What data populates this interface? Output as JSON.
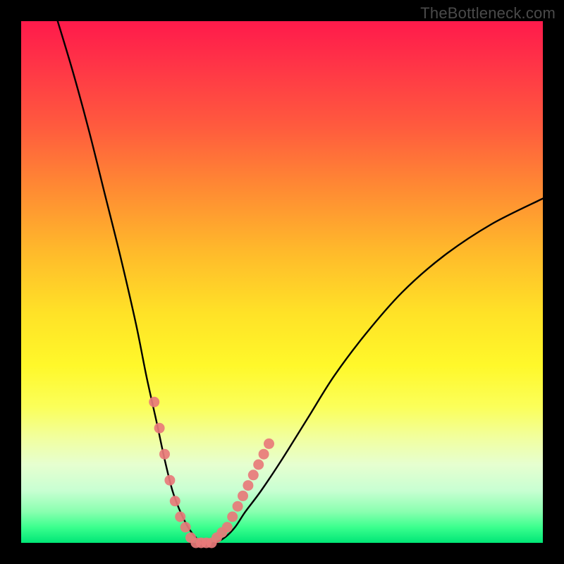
{
  "watermark": "TheBottleneck.com",
  "colors": {
    "frame": "#000000",
    "curve": "#000000",
    "marker": "#e87a7a",
    "gradient_top": "#ff1a4b",
    "gradient_bottom": "#00e676"
  },
  "chart_data": {
    "type": "line",
    "title": "",
    "xlabel": "",
    "ylabel": "",
    "xlim": [
      0,
      100
    ],
    "ylim": [
      0,
      100
    ],
    "grid": false,
    "legend": false,
    "note": "Bottleneck-style V-curve. x is a normalized hardware balance axis (0–100). y is estimated bottleneck percentage (0 at the valley, ~100 at the top). Values are read off the figure; no axis ticks are rendered, so all numbers are approximate to ±3.",
    "series": [
      {
        "name": "bottleneck-curve",
        "x": [
          7,
          10,
          13,
          16,
          19,
          22,
          24,
          26,
          27.5,
          29,
          30.5,
          32,
          33.5,
          35,
          37,
          39,
          41,
          43,
          46,
          50,
          55,
          60,
          66,
          73,
          81,
          90,
          100
        ],
        "y": [
          100,
          90,
          79,
          67,
          55,
          42,
          32,
          23,
          16,
          10,
          6,
          3,
          1,
          0,
          0,
          1,
          3,
          6,
          10,
          16,
          24,
          32,
          40,
          48,
          55,
          61,
          66
        ]
      }
    ],
    "markers": {
      "name": "highlighted-points",
      "note": "Salmon dots clustered around the valley on both arms of the V.",
      "x": [
        25.5,
        26.5,
        27.5,
        28.5,
        29.5,
        30.5,
        31.5,
        32.5,
        33.5,
        34.5,
        35.5,
        36.5,
        37.5,
        38.5,
        39.5,
        40.5,
        41.5,
        42.5,
        43.5,
        44.5,
        45.5,
        46.5,
        47.5
      ],
      "y": [
        27,
        22,
        17,
        12,
        8,
        5,
        3,
        1,
        0,
        0,
        0,
        0,
        1,
        2,
        3,
        5,
        7,
        9,
        11,
        13,
        15,
        17,
        19
      ]
    }
  }
}
